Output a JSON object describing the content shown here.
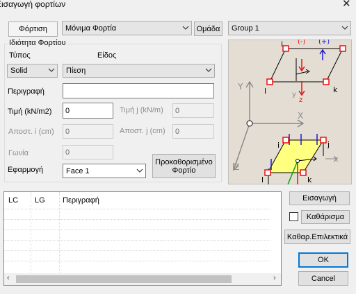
{
  "window": {
    "title": "Εισαγωγή φορτίων"
  },
  "top": {
    "tab_label": "Φόρτιση",
    "load_type_value": "Μόνιμα Φορτία",
    "group_button": "Ομάδα",
    "group_value": "Group 1"
  },
  "props": {
    "legend": "Ιδιότητα Φορτίου",
    "type_label": "Τύπος",
    "kind_label": "Είδος",
    "type_value": "Solid",
    "kind_value": "Πίεση",
    "description_label": "Περιγραφή",
    "description_value": "",
    "value_i_label": "Τιμή (kN/m2)",
    "value_i": "0",
    "value_j_label": "Τιμή j (kN/m)",
    "value_j": "0",
    "dist_i_label": "Αποστ. i (cm)",
    "dist_i": "0",
    "dist_j_label": "Αποστ. j (cm)",
    "dist_j": "0",
    "angle_label": "Γωνία",
    "angle": "0",
    "apply_label": "Εφαρμογή",
    "apply_value": "Face 1",
    "predefined_button": "Προκαθορισμένο Φορτίο"
  },
  "diagram": {
    "labels": {
      "x": "X",
      "y": "Y",
      "z": "Z",
      "i": "i",
      "j": "j",
      "k": "k",
      "l": "l",
      "small_x": "x",
      "small_y": "y",
      "small_z": "z",
      "plus": "(+)",
      "minus": "(-)"
    },
    "colors": {
      "bg": "#e3ddd4",
      "face": "#ffff80",
      "red": "#e81010",
      "blue": "#1a1ad6",
      "green": "#10a010",
      "axis": "#8a8a8a"
    }
  },
  "list": {
    "columns": [
      "LC",
      "LG",
      "Περιγραφή"
    ],
    "rows": []
  },
  "actions": {
    "insert": "Εισαγωγή",
    "clear_checkbox_checked": false,
    "clear": "Καθάρισμα",
    "clear_selected": "Καθαρ.Επιλεκτικά",
    "ok": "OK",
    "cancel": "Cancel"
  }
}
